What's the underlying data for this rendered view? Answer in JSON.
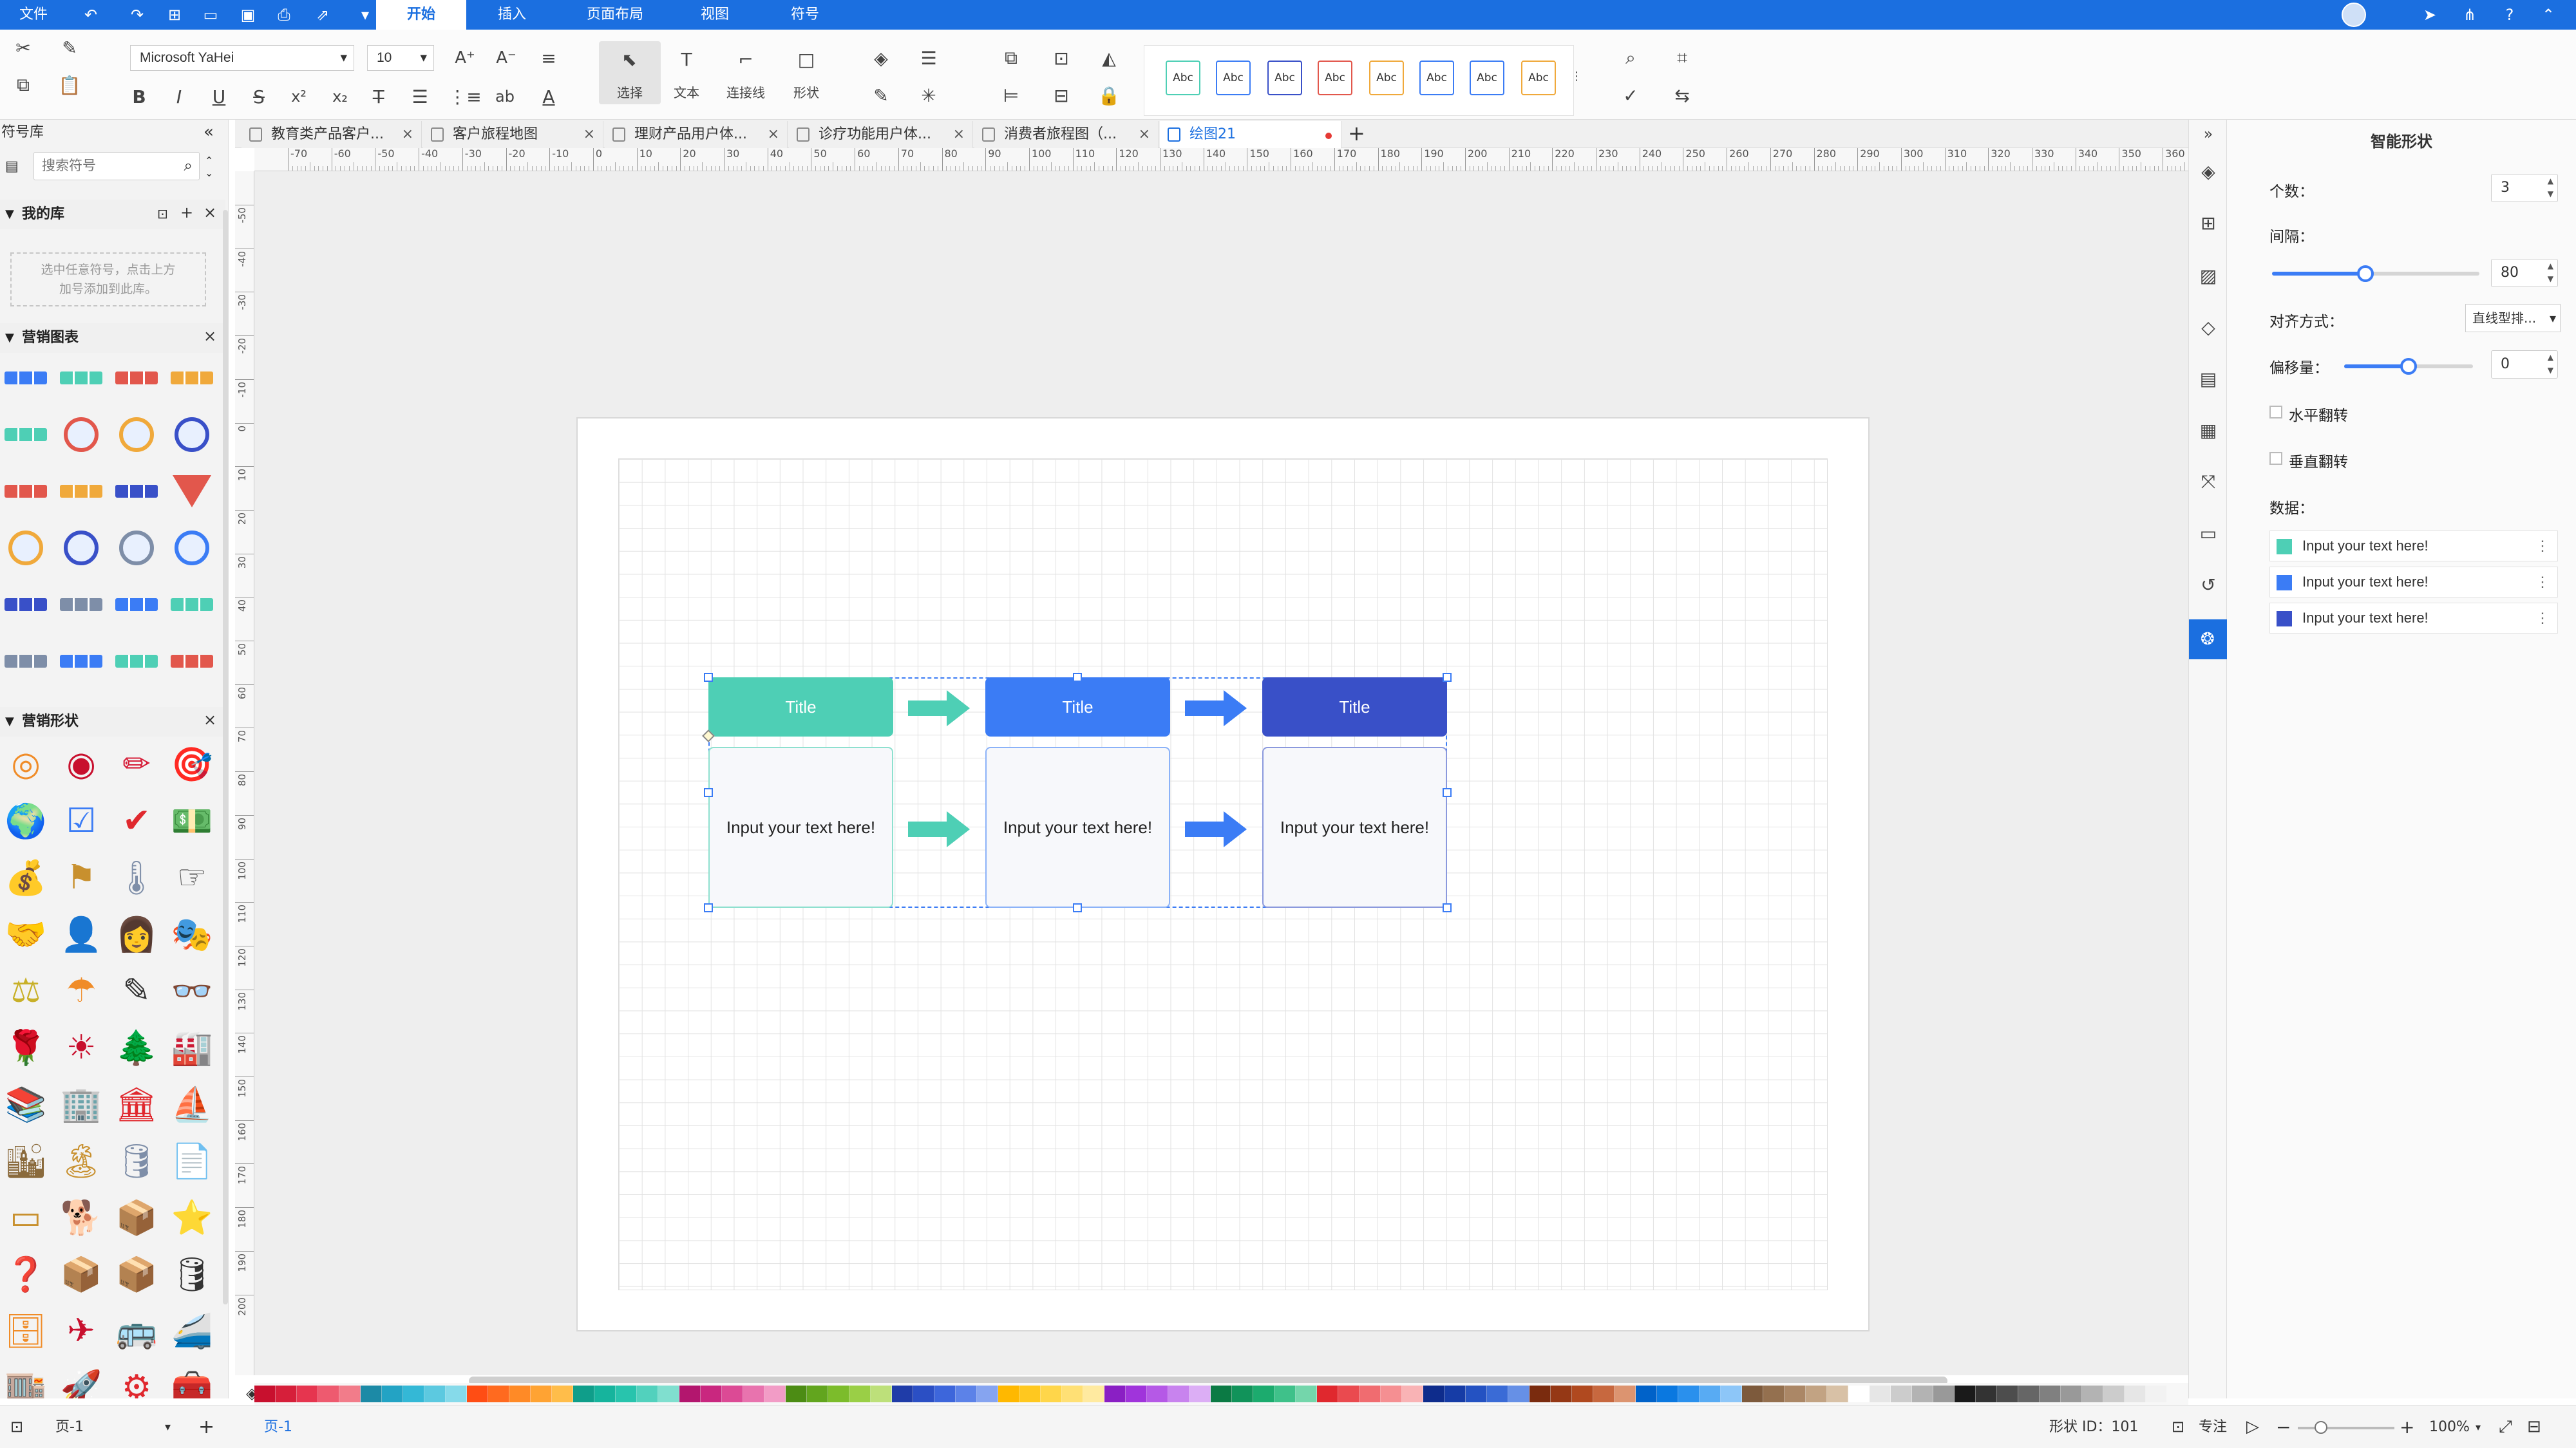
{
  "menu": {
    "file": "文件",
    "tabs": [
      "开始",
      "插入",
      "页面布局",
      "视图",
      "符号"
    ]
  },
  "ribbon": {
    "font_name": "Microsoft YaHei",
    "font_size": "10",
    "big_buttons": [
      "选择",
      "文本",
      "连接线",
      "形状"
    ],
    "style_presets": [
      "Abc",
      "Abc",
      "Abc",
      "Abc",
      "Abc",
      "Abc",
      "Abc",
      "Abc"
    ],
    "style_colors": [
      "#4ecfb5",
      "#3b7cf5",
      "#3950c8",
      "#e2574c",
      "#f0a93b",
      "#3b7cf5",
      "#3b7cf5",
      "#f0a93b"
    ]
  },
  "library": {
    "title": "符号库",
    "search_placeholder": "搜索符号",
    "my_library": "我的库",
    "my_library_hint": [
      "选中任意符号，点击上方",
      "加号添加到此库。"
    ],
    "sections": [
      "营销图表",
      "营销形状"
    ]
  },
  "doc_tabs": [
    "教育类产品客户...",
    "客户旅程地图",
    "理财产品用户体...",
    "诊疗功能用户体...",
    "消费者旅程图（...",
    "绘图21"
  ],
  "ruler": {
    "h": [
      "-70",
      "-60",
      "-50",
      "-40",
      "-30",
      "-20",
      "-10",
      "0",
      "10",
      "20",
      "30",
      "40",
      "50",
      "60",
      "70",
      "80",
      "90",
      "100",
      "110",
      "120",
      "130",
      "140",
      "150",
      "160",
      "170",
      "180",
      "190",
      "200",
      "210",
      "220",
      "230",
      "240",
      "250",
      "260",
      "270",
      "280",
      "290",
      "300",
      "310",
      "320",
      "330",
      "340",
      "350",
      "360"
    ],
    "v": [
      "-50",
      "-40",
      "-30",
      "-20",
      "-10",
      "0",
      "10",
      "20",
      "30",
      "40",
      "50",
      "60",
      "70",
      "80",
      "90",
      "100",
      "110",
      "120",
      "130",
      "140",
      "150",
      "160",
      "170",
      "180",
      "190",
      "200"
    ]
  },
  "diagram": {
    "columns": [
      {
        "title": "Title",
        "body": "Input your text here!",
        "color": "#4ecfb5"
      },
      {
        "title": "Title",
        "body": "Input your text here!",
        "color": "#3b7cf5"
      },
      {
        "title": "Title",
        "body": "Input your text here!",
        "color": "#3950c8"
      }
    ],
    "arrow_colors": [
      "#4ecfb5",
      "#3b7cf5"
    ]
  },
  "smart_shape": {
    "title": "智能形状",
    "count_label": "个数：",
    "count_value": "3",
    "spacing_label": "间隔：",
    "spacing_value": "80",
    "spacing_pct": 0.45,
    "align_label": "对齐方式：",
    "align_value": "直线型排...",
    "offset_label": "偏移量：",
    "offset_value": "0",
    "offset_pct": 0.5,
    "hflip_label": "水平翻转",
    "vflip_label": "垂直翻转",
    "data_label": "数据：",
    "data_items": [
      {
        "text": "Input your text here!",
        "color": "#4ecfb5"
      },
      {
        "text": "Input your text here!",
        "color": "#3b7cf5"
      },
      {
        "text": "Input your text here!",
        "color": "#3950c8"
      }
    ]
  },
  "status": {
    "page_name": "页-1",
    "active_page": "页-1",
    "shape_id": "形状 ID：101",
    "focus": "专注",
    "zoom": "100%"
  },
  "palette": [
    "#c8102e",
    "#d61f3a",
    "#e6354f",
    "#ee5a6f",
    "#f27c8a",
    "#1c8aa6",
    "#23a3c4",
    "#34b8d6",
    "#5cc9e0",
    "#86daea",
    "#ff4d14",
    "#ff6a1f",
    "#ff8a26",
    "#ffa333",
    "#ffbd4a",
    "#0f9e8a",
    "#16b49d",
    "#28c4ad",
    "#52d1bd",
    "#80dfcf",
    "#b3166e",
    "#c9277f",
    "#dc4a95",
    "#e873ae",
    "#f29cc6",
    "#4c8c14",
    "#62a51e",
    "#7cbc2b",
    "#9acf46",
    "#bde07a",
    "#1f3ca8",
    "#2b4fc4",
    "#3d66db",
    "#5c82e8",
    "#86a4f0",
    "#ffb800",
    "#ffc81f",
    "#ffd64a",
    "#ffe075",
    "#ffeaa0",
    "#8a1fc4",
    "#a034db",
    "#b559e6",
    "#c883ee",
    "#dcaef5",
    "#0b7a44",
    "#11935a",
    "#1cab6e",
    "#3fc18a",
    "#74d6ab",
    "#e0282e",
    "#ea4a4f",
    "#f06c70",
    "#f58f92",
    "#f9b3b5",
    "#0e2c8c",
    "#163ca6",
    "#2452c2",
    "#3a6bd6",
    "#6690e6",
    "#7a2b0e",
    "#953815",
    "#b0491f",
    "#c7683f",
    "#dc9470",
    "#0062c9",
    "#0a78e0",
    "#2a90ed",
    "#58abf3",
    "#8dc6f8",
    "#7d5a3c",
    "#94704f",
    "#ab8766",
    "#c2a383",
    "#d8c1a6",
    "#ffffff",
    "#e6e6e6",
    "#cccccc",
    "#b3b3b3",
    "#999999",
    "#1a1a1a",
    "#333333",
    "#4d4d4d",
    "#666666",
    "#808080",
    "#999999",
    "#b3b3b3",
    "#cccccc",
    "#e6e6e6",
    "#f2f2f2"
  ]
}
